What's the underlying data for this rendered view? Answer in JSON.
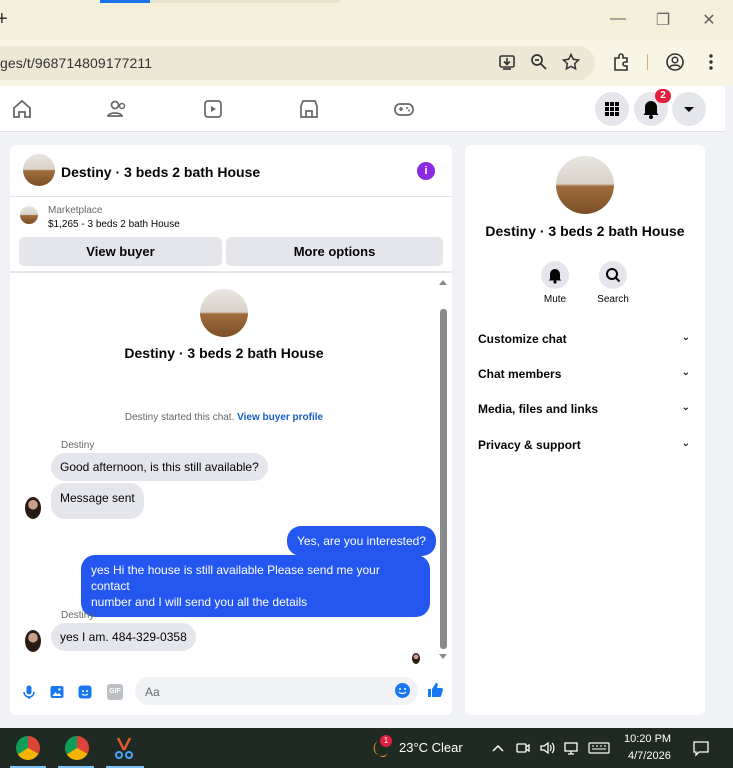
{
  "browser": {
    "url": "ges/t/968714809177211",
    "new_tab_glyph": "+",
    "window_controls": {
      "minimize": "—",
      "restore": "❐",
      "close": "✕"
    }
  },
  "fb_nav": {
    "notification_count": "2",
    "icons": [
      "home-icon",
      "friends-icon",
      "video-icon",
      "marketplace-icon",
      "gaming-icon",
      "menu-grid-icon",
      "bell-icon",
      "account-dropdown-icon"
    ]
  },
  "chat": {
    "title": "Destiny · 3 beds 2 bath House",
    "info_glyph": "i",
    "marketplace_label": "Marketplace",
    "listing": "$1,265 - 3 beds 2 bath House",
    "view_buyer": "View buyer",
    "more_options": "More options",
    "intro_title": "Destiny · 3 beds 2 bath House",
    "started_text": "Destiny started this chat.",
    "view_buyer_profile": "View buyer profile",
    "messages": [
      {
        "sender": "Destiny",
        "text": "Good afternoon, is this still available?"
      },
      {
        "text": "Message sent"
      },
      {
        "text": "Yes, are you interested?"
      },
      {
        "text_line1": "yes Hi the house is still available Please send me your contact",
        "text_line2": "number and I will send you all the details"
      },
      {
        "sender": "Destiny",
        "text": "yes I am. 484-329-0358"
      }
    ],
    "composer_placeholder": "Aa",
    "gif_label": "GIF"
  },
  "details": {
    "title": "Destiny · 3 beds 2 bath House",
    "mute": "Mute",
    "search": "Search",
    "rows": [
      "Customize chat",
      "Chat members",
      "Media, files and links",
      "Privacy & support"
    ],
    "chevron": "⌄"
  },
  "taskbar": {
    "weather_badge": "1",
    "weather": "23°C  Clear",
    "time": "10:20 PM",
    "date": "4/7/2026"
  },
  "colors": {
    "messenger_blue": "#2457f0",
    "fb_blue": "#1877f2",
    "info_purple": "#8a2be2",
    "badge_red": "#e41e3f"
  }
}
